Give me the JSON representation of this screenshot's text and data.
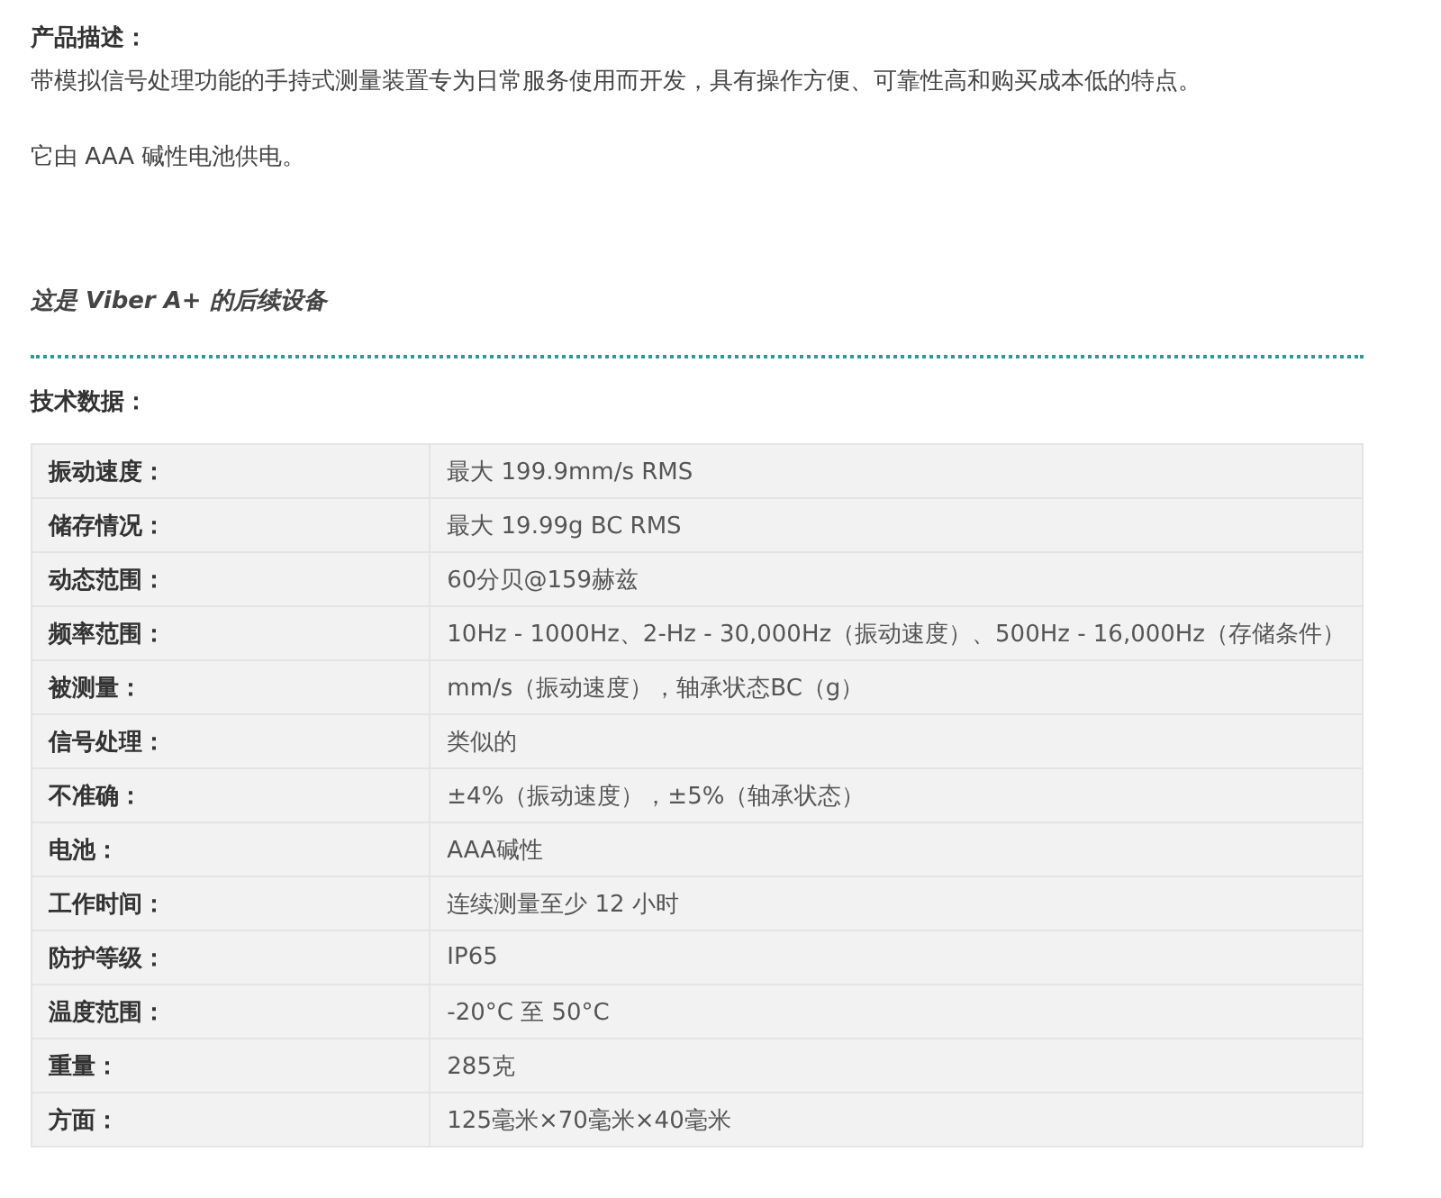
{
  "description_heading": "产品描述：",
  "paragraphs": [
    "带模拟信号处理功能的手持式测量装置专为日常服务使用而开发，具有操作方便、可靠性高和购买成本低的特点。",
    "它由 AAA 碱性电池供电。"
  ],
  "successor_note": "这是 Viber A+ 的后续设备",
  "specs_heading": "技术数据：",
  "specs": [
    {
      "label": "振动速度：",
      "value": "最大 199.9mm/s RMS"
    },
    {
      "label": "储存情况：",
      "value": "最大 19.99g BC RMS"
    },
    {
      "label": "动态范围：",
      "value": "60分贝@159赫兹"
    },
    {
      "label": "频率范围：",
      "value": "10Hz - 1000Hz、2-Hz - 30,000Hz（振动速度）、500Hz - 16,000Hz（存储条件）"
    },
    {
      "label": "被测量：",
      "value": "mm/s（振动速度），轴承状态BC（g）"
    },
    {
      "label": "信号处理：",
      "value": "类似的"
    },
    {
      "label": "不准确：",
      "value": "±4%（振动速度），±5%（轴承状态）"
    },
    {
      "label": "电池：",
      "value": "AAA碱性"
    },
    {
      "label": "工作时间：",
      "value": "连续测量至少 12 小时"
    },
    {
      "label": "防护等级：",
      "value": "IP65"
    },
    {
      "label": "温度范围：",
      "value": "-20°C 至 50°C"
    },
    {
      "label": "重量：",
      "value": "285克"
    },
    {
      "label": "方面：",
      "value": "125毫米×70毫米×40毫米"
    }
  ]
}
